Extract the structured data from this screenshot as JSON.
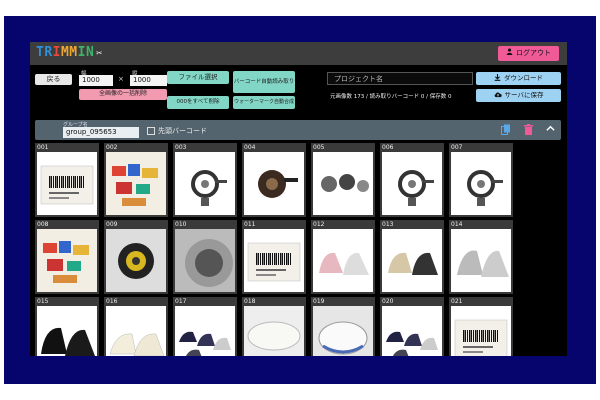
{
  "header": {
    "logo": {
      "p1": "TR",
      "p2": "I",
      "p3": "MM",
      "p4": "IN",
      "cut": "✂"
    },
    "logout_label": "ログアウト",
    "logout_icon": "person-icon"
  },
  "toolbar": {
    "back_label": "戻る",
    "width_label": "幅",
    "width_value": "1000",
    "height_label": "縦",
    "height_value": "1000",
    "times": "×",
    "bulk_delete_label": "全画像の一括削除",
    "file_select_label": "ファイル選択",
    "barcode_read_label": "バーコード自動読み取り",
    "reset_all_label": "000をすべて削除",
    "watermark_label": "ウォーターマーク自動合成",
    "project_placeholder": "プロジェクト名",
    "stats_text": "元画像数 173 / 読み取りバーコード 0 / 保存数 0",
    "download_label": "ダウンロード",
    "save_server_label": "サーバに保存"
  },
  "group": {
    "label": "グループ名",
    "value": "group_095653",
    "checkbox_label": "先頭バーコード"
  },
  "colors": {
    "accent_pink": "#ef5a97",
    "teal": "#82d6c6",
    "blue": "#9ed2f2",
    "bg": "#05056d"
  },
  "thumbnails": [
    {
      "no": "001",
      "kind": "barcode"
    },
    {
      "no": "002",
      "kind": "toys"
    },
    {
      "no": "003",
      "kind": "reel"
    },
    {
      "no": "004",
      "kind": "reel-dark"
    },
    {
      "no": "005",
      "kind": "reel-multi"
    },
    {
      "no": "006",
      "kind": "reel"
    },
    {
      "no": "007",
      "kind": "reel"
    },
    {
      "no": "008",
      "kind": "toys"
    },
    {
      "no": "009",
      "kind": "reel-yellow"
    },
    {
      "no": "010",
      "kind": "reel-closeup"
    },
    {
      "no": "011",
      "kind": "barcode"
    },
    {
      "no": "012",
      "kind": "sneakers-pink"
    },
    {
      "no": "013",
      "kind": "sneakers-beige"
    },
    {
      "no": "014",
      "kind": "sneakers-grey"
    },
    {
      "no": "015",
      "kind": "sneakers-black"
    },
    {
      "no": "016",
      "kind": "sneakers-cream"
    },
    {
      "no": "017",
      "kind": "sneakers-multi"
    },
    {
      "no": "018",
      "kind": "shoe-closeup"
    },
    {
      "no": "019",
      "kind": "shoe-closeup-blue"
    },
    {
      "no": "020",
      "kind": "sneakers-multi"
    },
    {
      "no": "021",
      "kind": "barcode"
    }
  ]
}
